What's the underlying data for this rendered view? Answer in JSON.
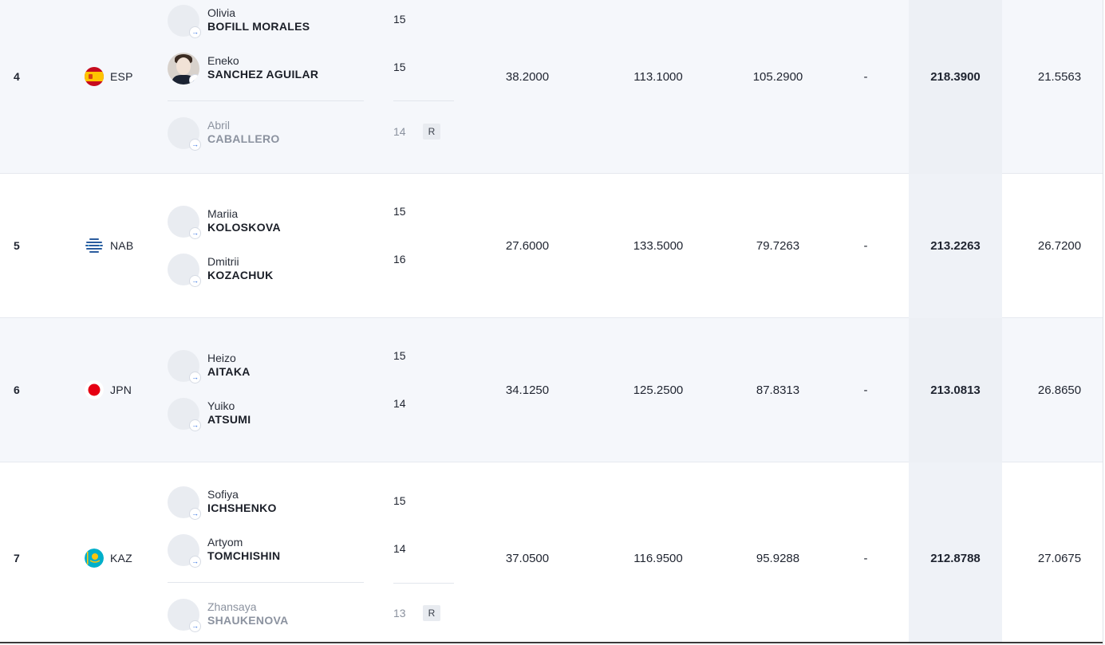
{
  "rows": [
    {
      "rank": "4",
      "noc": "ESP",
      "flag_icon": "spain-flag-icon",
      "athletes": [
        {
          "first": "Olivia",
          "last": "BOFILL MORALES",
          "age": "15"
        },
        {
          "first": "Eneko",
          "last": "SANCHEZ AGUILAR",
          "age": "15"
        }
      ],
      "reserve": {
        "first": "Abril",
        "last": "CABALLERO",
        "age": "14",
        "badge": "R"
      },
      "col1": "38.2000",
      "col2": "113.1000",
      "col3": "105.2900",
      "col4": "-",
      "total": "218.3900",
      "col6": "21.5563"
    },
    {
      "rank": "5",
      "noc": "NAB",
      "flag_icon": "neutral-athletes-icon",
      "athletes": [
        {
          "first": "Mariia",
          "last": "KOLOSKOVA",
          "age": "15"
        },
        {
          "first": "Dmitrii",
          "last": "KOZACHUK",
          "age": "16"
        }
      ],
      "col1": "27.6000",
      "col2": "133.5000",
      "col3": "79.7263",
      "col4": "-",
      "total": "213.2263",
      "col6": "26.7200"
    },
    {
      "rank": "6",
      "noc": "JPN",
      "flag_icon": "japan-flag-icon",
      "athletes": [
        {
          "first": "Heizo",
          "last": "AITAKA",
          "age": "15"
        },
        {
          "first": "Yuiko",
          "last": "ATSUMI",
          "age": "14"
        }
      ],
      "col1": "34.1250",
      "col2": "125.2500",
      "col3": "87.8313",
      "col4": "-",
      "total": "213.0813",
      "col6": "26.8650"
    },
    {
      "rank": "7",
      "noc": "KAZ",
      "flag_icon": "kazakhstan-flag-icon",
      "athletes": [
        {
          "first": "Sofiya",
          "last": "ICHSHENKO",
          "age": "15"
        },
        {
          "first": "Artyom",
          "last": "TOMCHISHIN",
          "age": "14"
        }
      ],
      "reserve": {
        "first": "Zhansaya",
        "last": "SHAUKENOVA",
        "age": "13",
        "badge": "R"
      },
      "col1": "37.0500",
      "col2": "116.9500",
      "col3": "95.9288",
      "col4": "-",
      "total": "212.8788",
      "col6": "27.0675"
    }
  ],
  "colors": {
    "row_shaded": "#f5f7fb",
    "total_band": "#eff2f7",
    "avatar_badge_arrow": "#2d6cdf",
    "reserve_text": "#8b929f"
  },
  "avatar_badge_icon": "arrow-right-icon"
}
